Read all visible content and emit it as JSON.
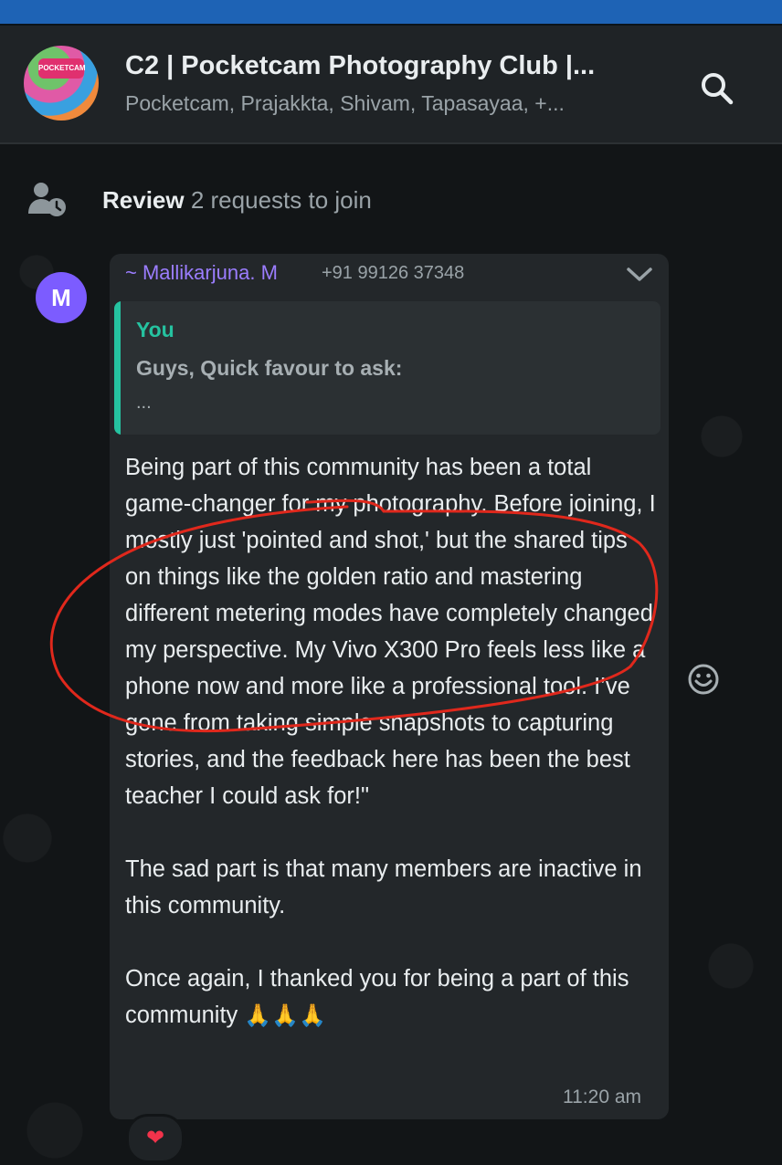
{
  "header": {
    "group_title": "C2 | Pocketcam Photography Club |...",
    "members": "Pocketcam, Prajakkta, Shivam, Tapasayaa, +...",
    "avatar_badge": "POCKETCAM"
  },
  "review": {
    "label": "Review",
    "sub": "2 requests to join"
  },
  "message": {
    "avatar_letter": "M",
    "sender_name": "~ Mallikarjuna. M",
    "sender_phone": "+91 99126 37348",
    "quote": {
      "author": "You",
      "text": "Guys, Quick favour to ask:",
      "more": "..."
    },
    "paragraph1": "Being part of this community has been a total game-changer for my photography. Before joining, I mostly just 'pointed and shot,' but the shared tips on things like the golden ratio and mastering different metering modes have completely changed my perspective. My Vivo X300 Pro feels less like a phone now and more like a professional tool. I’ve gone from taking simple snapshots to capturing stories, and the feedback here has been the best teacher I could ask for!\"",
    "paragraph2": "The sad part is that many members are inactive in this community.",
    "paragraph3": "Once again, I thanked you for being a part of this community",
    "pray_emojis": "🙏🙏🙏",
    "time": "11:20 am",
    "reaction": "❤"
  },
  "icons": {
    "search": "search-icon",
    "review": "person-clock-icon",
    "chevron": "chevron-down-icon",
    "emoji": "smiley-icon"
  },
  "colors": {
    "accent_green": "#25c2a0",
    "sender_purple": "#9b7dff",
    "annotation_red": "#e0281c"
  }
}
